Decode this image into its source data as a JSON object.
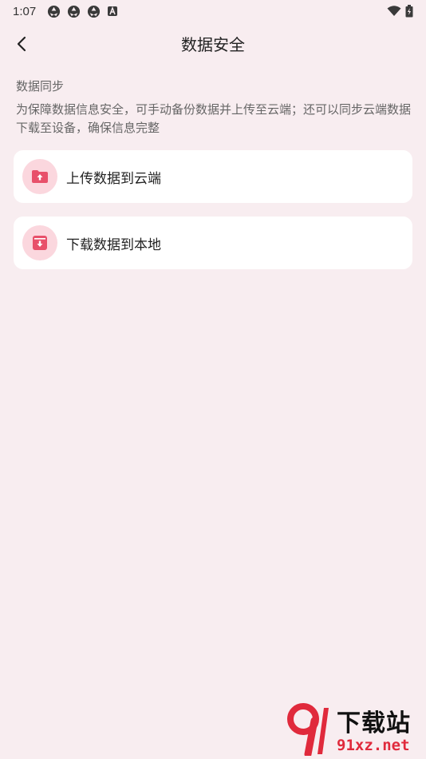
{
  "status": {
    "time": "1:07",
    "icons": [
      "aperture-icon",
      "aperture-icon",
      "aperture-icon",
      "a-square-icon"
    ],
    "right_icons": [
      "wifi-icon",
      "battery-icon"
    ]
  },
  "header": {
    "title": "数据安全",
    "back_icon": "chevron-left-icon"
  },
  "section": {
    "title": "数据同步",
    "description": "为保障数据信息安全，可手动备份数据并上传至云端；还可以同步云端数据下载至设备，确保信息完整"
  },
  "actions": [
    {
      "label": "上传数据到云端",
      "icon": "folder-upload-icon"
    },
    {
      "label": "下载数据到本地",
      "icon": "box-download-icon"
    }
  ],
  "watermark": {
    "logo_text": "91",
    "title": "下载站",
    "url": "91xz.net"
  },
  "colors": {
    "background": "#f8edf0",
    "accent": "#e8506a",
    "icon_bg": "#fbd7de"
  }
}
